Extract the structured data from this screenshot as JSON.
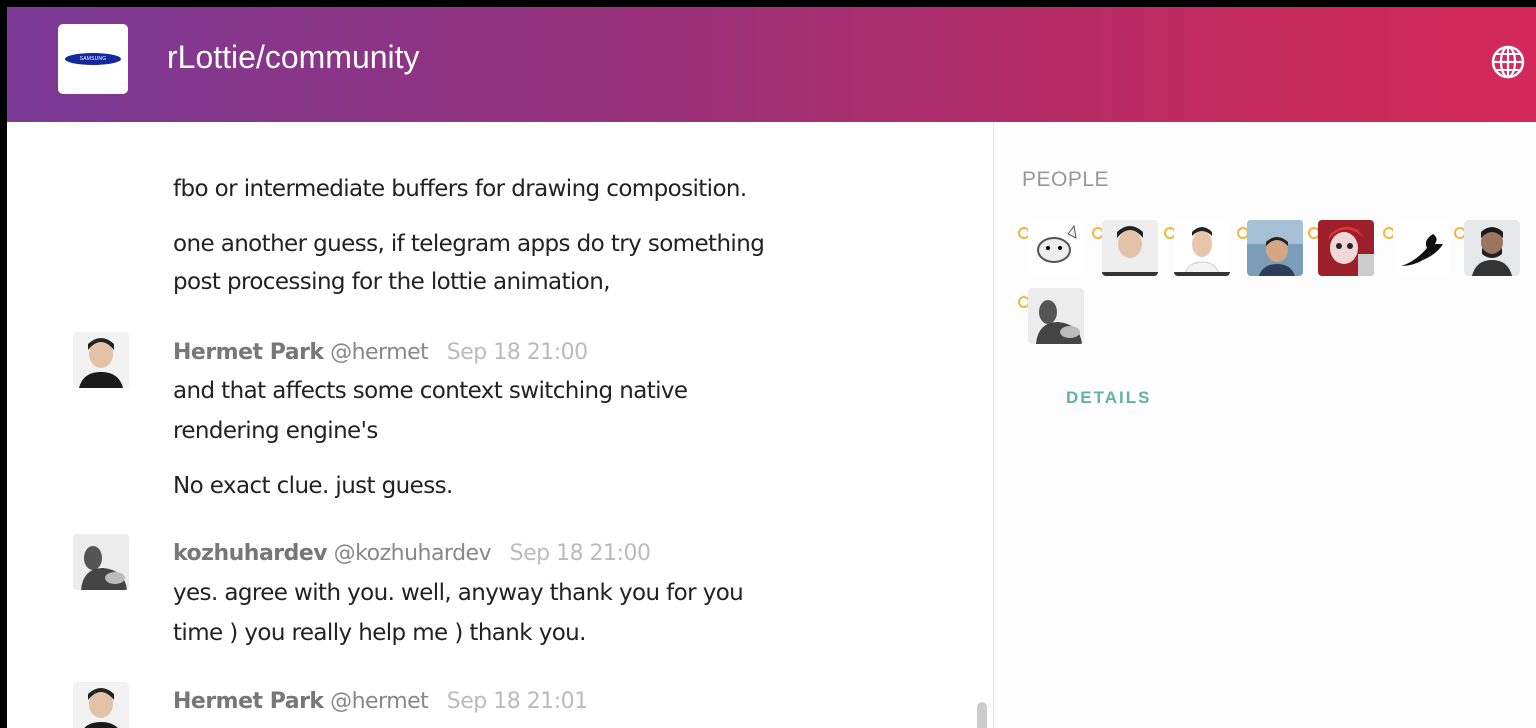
{
  "header": {
    "logo_text": "SAMSUNG",
    "room_title": "rLottie/community",
    "globe_icon": "globe-icon"
  },
  "chat": {
    "continuation_lines": [
      "fbo or intermediate buffers for drawing composition.",
      "one another guess, if telegram apps do try something",
      "post processing for the lottie animation,"
    ],
    "messages": [
      {
        "name": "Hermet Park",
        "user": "@hermet",
        "time": "Sep 18 21:00",
        "lines": [
          "and that affects some context switching native",
          "rendering engine's"
        ],
        "extra": "No exact clue. just guess."
      },
      {
        "name": "kozhuhardev",
        "user": "@kozhuhardev",
        "time": "Sep 18 21:00",
        "lines": [
          "yes. agree with you. well, anyway thank you for you",
          "time ) you really help me ) thank you."
        ]
      },
      {
        "name": "Hermet Park",
        "user": "@hermet",
        "time": "Sep 18 21:01"
      }
    ]
  },
  "sidebar": {
    "people_label": "PEOPLE",
    "details_label": "DETAILS"
  },
  "colors": {
    "header_start": "#7a3a96",
    "header_end": "#d4285a",
    "details": "#5fb3a4",
    "status_dot": "#f1b73a"
  }
}
